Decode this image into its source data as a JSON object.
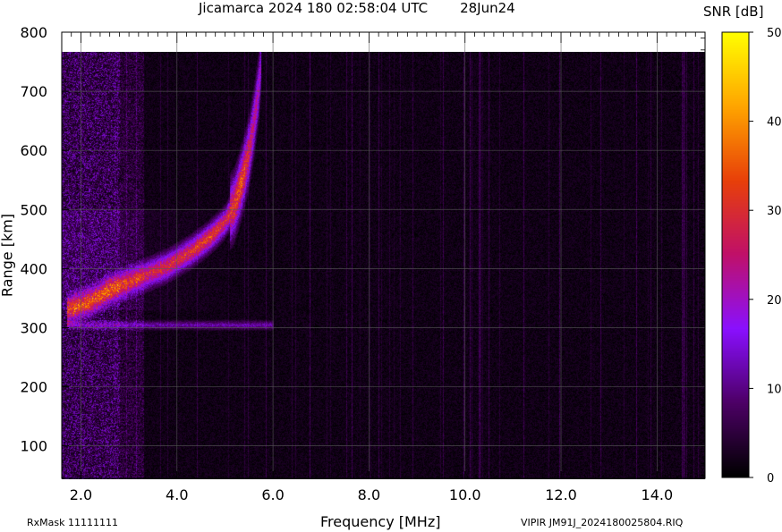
{
  "header": {
    "title": "Jicamarca 2024 180 02:58:04 UTC",
    "date": "28Jun24"
  },
  "colorbar": {
    "label": "SNR [dB]",
    "range": [
      0,
      50
    ],
    "ticks": [
      "0",
      "10",
      "20",
      "30",
      "40",
      "50"
    ]
  },
  "footer": {
    "rxmask": "RxMask 11111111",
    "file": "VIPIR  JM91J_2024180025804.RIQ"
  },
  "chart_data": {
    "type": "heatmap",
    "title": "Jicamarca 2024 180 02:58:04 UTC",
    "xlabel": "Frequency [MHz]",
    "ylabel": "Range [km]",
    "xlim": [
      1.6,
      15.0
    ],
    "ylim": [
      45,
      800
    ],
    "data_range_y": [
      45,
      768
    ],
    "xticks": [
      "2.0",
      "4.0",
      "6.0",
      "8.0",
      "10.0",
      "12.0",
      "14.0"
    ],
    "yticks": [
      "100",
      "200",
      "300",
      "400",
      "500",
      "600",
      "700",
      "800"
    ],
    "grid": true,
    "colormap": "black-purple-red-orange-yellow",
    "colormap_colors": [
      "#000000",
      "#4d0066",
      "#8a10ff",
      "#c0106a",
      "#e8400a",
      "#ffa500",
      "#ffff00"
    ],
    "value_range": [
      0,
      50
    ],
    "trace": {
      "name": "",
      "points": [
        {
          "f": 1.7,
          "h": 330,
          "snr": 26
        },
        {
          "f": 2.2,
          "h": 345,
          "snr": 25
        },
        {
          "f": 2.6,
          "h": 365,
          "snr": 27
        },
        {
          "f": 3.2,
          "h": 385,
          "snr": 25
        },
        {
          "f": 3.8,
          "h": 405,
          "snr": 26
        },
        {
          "f": 4.3,
          "h": 430,
          "snr": 28
        },
        {
          "f": 4.7,
          "h": 455,
          "snr": 30
        },
        {
          "f": 5.0,
          "h": 480,
          "snr": 26
        },
        {
          "f": 5.2,
          "h": 510,
          "snr": 30
        },
        {
          "f": 5.35,
          "h": 550,
          "snr": 32
        },
        {
          "f": 5.5,
          "h": 600,
          "snr": 25
        },
        {
          "f": 5.6,
          "h": 650,
          "snr": 22
        },
        {
          "f": 5.7,
          "h": 710,
          "snr": 18
        },
        {
          "f": 5.75,
          "h": 760,
          "snr": 14
        }
      ]
    },
    "secondary_echo": {
      "f_min": 1.7,
      "f_max": 6.0,
      "h": 305,
      "snr": 12
    }
  }
}
